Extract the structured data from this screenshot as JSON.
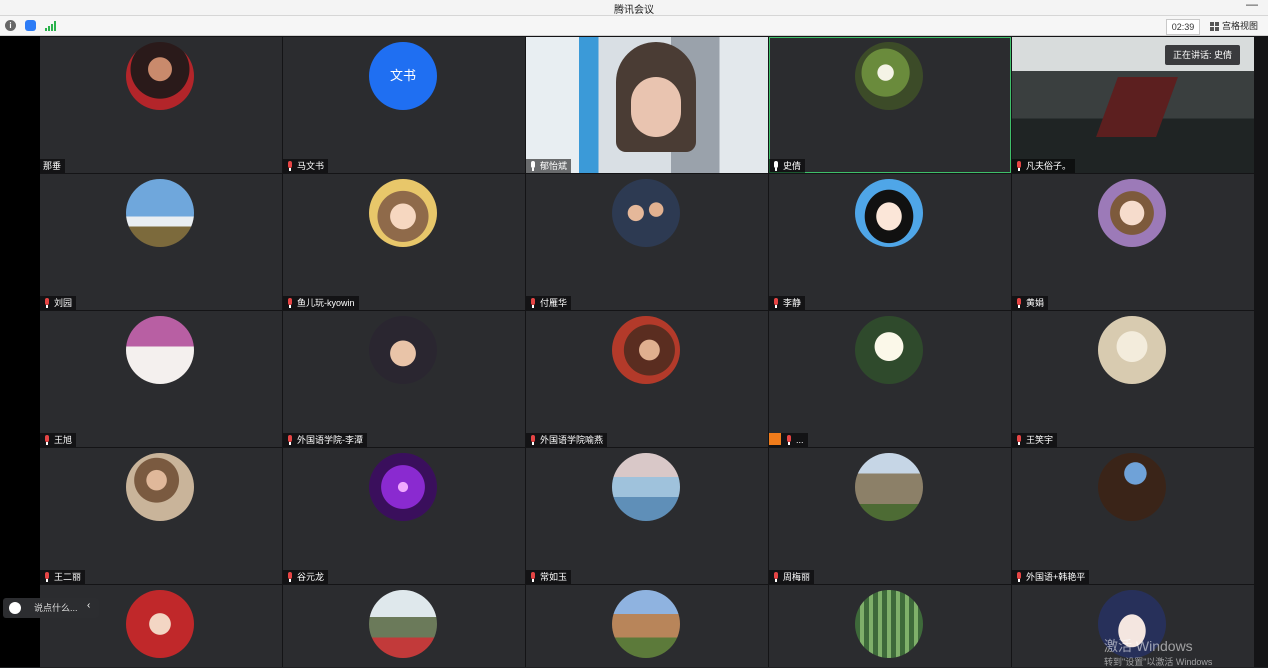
{
  "app": {
    "title": "腾讯会议"
  },
  "toolbar": {
    "timer": "02:39",
    "view_label": "宫格视图"
  },
  "speaking": {
    "label": "正在讲话: 史倩"
  },
  "chat": {
    "placeholder": "说点什么..."
  },
  "watermark": {
    "line1": "激活 Windows",
    "line2": "转到\"设置\"以激活 Windows"
  },
  "colors": {
    "accent": "#1f6ff2",
    "active_border": "#3fbf6a",
    "muted_mic": "#e64545",
    "tile_bg": "#2b2c2f"
  },
  "participants": [
    {
      "name": "那垂",
      "mic": "none"
    },
    {
      "name": "马文书",
      "mic": "muted",
      "avatar_text": "文书"
    },
    {
      "name": "郁怡斌",
      "mic": "on"
    },
    {
      "name": "史倩",
      "mic": "on"
    },
    {
      "name": "凡夫俗子。",
      "mic": "muted"
    },
    {
      "name": "刘园",
      "mic": "muted"
    },
    {
      "name": "鱼儿玩-kyowin",
      "mic": "muted"
    },
    {
      "name": "付雁华",
      "mic": "muted"
    },
    {
      "name": "李静",
      "mic": "muted"
    },
    {
      "name": "黄娟",
      "mic": "muted"
    },
    {
      "name": "王旭",
      "mic": "muted"
    },
    {
      "name": "外国语学院-李潭",
      "mic": "muted"
    },
    {
      "name": "外国语学院喻燕",
      "mic": "muted"
    },
    {
      "name": "...",
      "mic": "muted"
    },
    {
      "name": "王笑宇",
      "mic": "muted"
    },
    {
      "name": "王二丽",
      "mic": "muted"
    },
    {
      "name": "谷元龙",
      "mic": "muted"
    },
    {
      "name": "常如玉",
      "mic": "muted"
    },
    {
      "name": "周梅丽",
      "mic": "muted"
    },
    {
      "name": "外国语+韩艳平",
      "mic": "muted"
    }
  ]
}
